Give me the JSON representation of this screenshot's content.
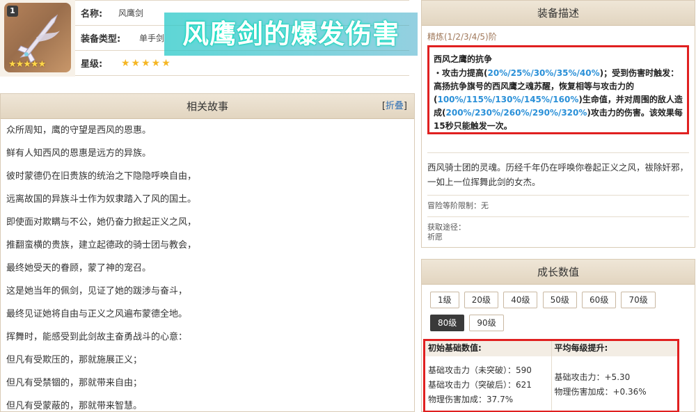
{
  "weapon": {
    "rarity_badge": "1",
    "thumb_stars": "★★★★★",
    "name_label": "名称:",
    "name_value": "风鹰剑",
    "type_label": "装备类型:",
    "type_value": "单手剑",
    "stars_label": "星级:",
    "stars_value": "★★★★★"
  },
  "overlay_title": "风鹰剑的爆发伤害",
  "story": {
    "title": "相关故事",
    "fold_bracket_open": "[",
    "fold_label": "折叠",
    "fold_bracket_close": "]",
    "lines": [
      "众所周知，鹰的守望是西风的恩惠。",
      "鲜有人知西风的恩惠是远方的异族。",
      "彼时蒙德仍在旧贵族的统治之下隐隐呼唤自由，",
      "远离故国的异族斗士作为奴隶踏入了风的国土。",
      "即使面对欺瞒与不公，她仍奋力掀起正义之风，",
      "推翻蛮横的贵族，建立起德政的骑士团与教会，",
      "最终她受天的眷顾，蒙了神的宠召。",
      "这是她当年的佩剑，见证了她的跋涉与奋斗，",
      "最终见证她将自由与正义之风遍布蒙德全地。",
      "挥舞时，能感受到此剑故主奋勇战斗的心意：",
      "但凡有受欺压的，那就施展正义；",
      "但凡有受禁锢的，那就带来自由；",
      "但凡有受蒙蔽的，那就带来智慧。"
    ]
  },
  "description": {
    "title": "装备描述",
    "refine": "精炼(1/2/3/4/5)阶",
    "passive_name": "西风之鹰的抗争",
    "passive_p1": "・攻击力提高(",
    "passive_v1": "20%/25%/30%/35%/40%",
    "passive_p2": ")；受到伤害时触发：高扬抗争旗号的西风鹰之魂苏醒，恢复相等与攻击力的(",
    "passive_v2": "100%/115%/130%/145%/160%",
    "passive_p3": ")生命值，并对周围的敌人造成(",
    "passive_v3": "200%/230%/260%/290%/320%",
    "passive_p4": ")攻击力的伤害。该效果每15秒只能触发一次。",
    "lore": "西风骑士团的灵魂。历经千年仍在呼唤你卷起正义之风，祓除奸邪，一如上一位挥舞此剑的女杰。",
    "ascension_limit": "冒险等阶限制：无",
    "source_label": "获取途径：",
    "source_value": "祈愿"
  },
  "growth": {
    "title": "成长数值",
    "levels": [
      "1级",
      "20级",
      "40级",
      "50级",
      "60级",
      "70级",
      "80级",
      "90级"
    ],
    "active_level": "80级",
    "base_head": "初始基础数值:",
    "avg_head": "平均每级提升:",
    "base_stats": [
      "基础攻击力（未突破）：590",
      "基础攻击力（突破后）：621",
      "物理伤害加成：37.7%"
    ],
    "avg_stats": [
      "基础攻击力：+5.30",
      "物理伤害加成：+0.36%"
    ]
  }
}
